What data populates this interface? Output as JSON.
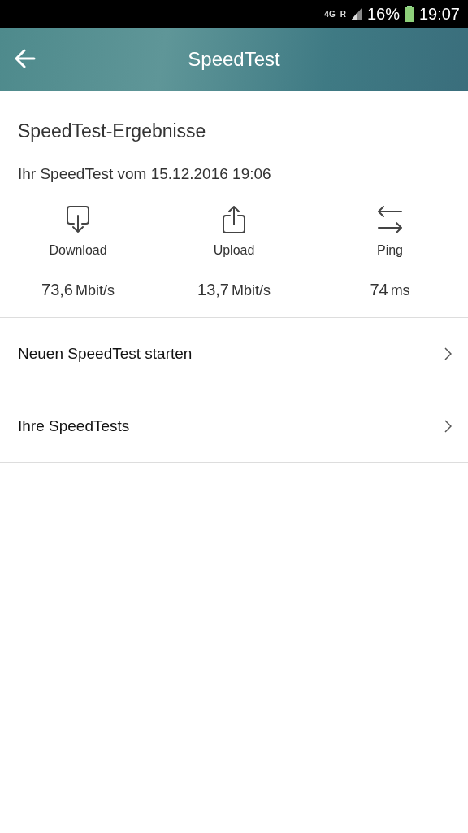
{
  "status_bar": {
    "network": "4G",
    "roaming": "R",
    "battery": "16%",
    "time": "19:07"
  },
  "header": {
    "title": "SpeedTest"
  },
  "results": {
    "title": "SpeedTest-Ergebnisse",
    "subtitle": "Ihr SpeedTest vom 15.12.2016 19:06",
    "metrics": [
      {
        "kind": "download",
        "label": "Download",
        "value": "73,6",
        "unit": "Mbit/s"
      },
      {
        "kind": "upload",
        "label": "Upload",
        "value": "13,7",
        "unit": "Mbit/s"
      },
      {
        "kind": "ping",
        "label": "Ping",
        "value": "74",
        "unit": "ms"
      }
    ]
  },
  "menu": [
    {
      "label": "Neuen SpeedTest starten"
    },
    {
      "label": "Ihre SpeedTests"
    }
  ]
}
